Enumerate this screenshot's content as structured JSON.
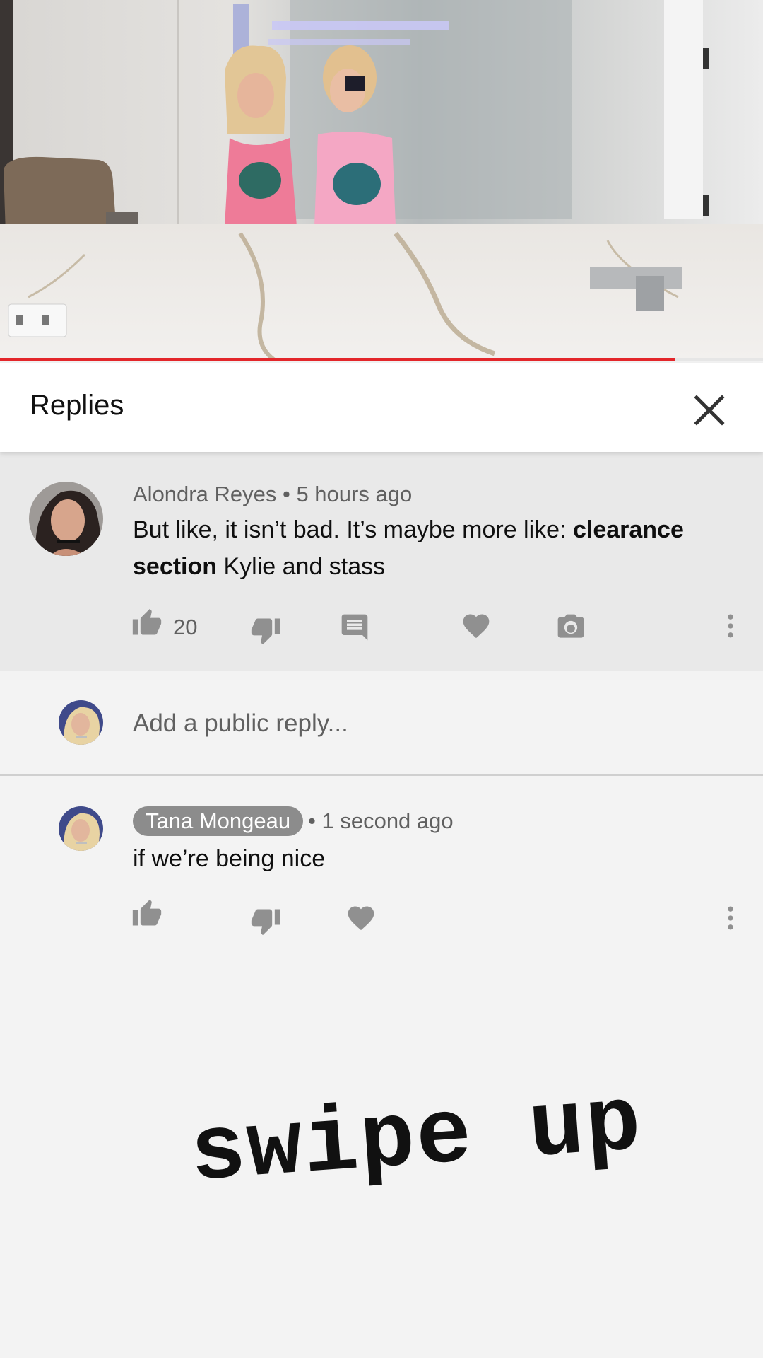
{
  "video": {
    "progress": 0.885,
    "scene": "video-frame"
  },
  "header": {
    "title": "Replies",
    "close_icon": "close-icon"
  },
  "comment": {
    "author": "Alondra Reyes",
    "separator": "•",
    "time": "5 hours ago",
    "text_part1": "But like, it isn’t bad. It’s maybe more like: ",
    "text_bold": "clearance section",
    "text_part2": " Kylie and stass",
    "likes": "20",
    "actions": [
      "thumbs-up-icon",
      "thumbs-down-icon",
      "reply-icon",
      "heart-icon",
      "camera-icon",
      "more-vert-icon"
    ]
  },
  "reply_input": {
    "placeholder": "Add a public reply..."
  },
  "reply": {
    "author": "Tana Mongeau",
    "separator": "•",
    "time": "1 second ago",
    "text": "if we’re being nice",
    "actions": [
      "thumbs-up-icon",
      "thumbs-down-icon",
      "heart-icon",
      "more-vert-icon"
    ]
  },
  "overlay": {
    "text": "swipe up"
  },
  "colors": {
    "progress": "#e3262a",
    "chip": "#8c8c8c",
    "icon": "#909090"
  }
}
